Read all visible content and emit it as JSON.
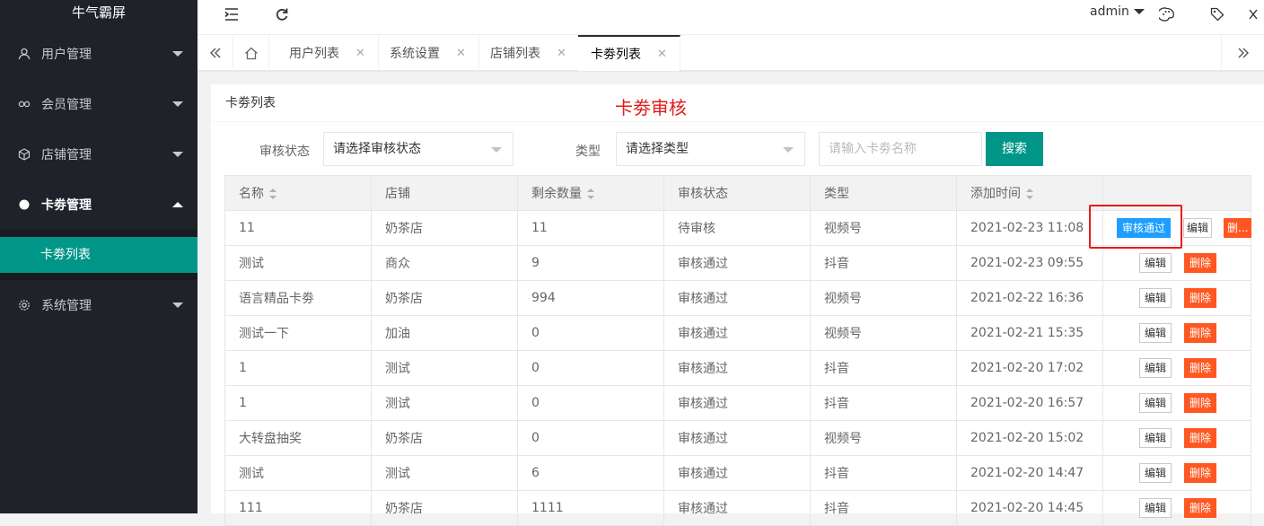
{
  "app": {
    "title": "牛气霸屏"
  },
  "sidebar": {
    "items": [
      {
        "label": "用户管理",
        "icon": "user-icon"
      },
      {
        "label": "会员管理",
        "icon": "link-icon"
      },
      {
        "label": "店铺管理",
        "icon": "box-icon"
      },
      {
        "label": "卡劵管理",
        "icon": "circle-icon"
      },
      {
        "label": "系统管理",
        "icon": "gear-icon"
      }
    ],
    "subitem": "卡劵列表"
  },
  "topbar": {
    "user": "admin"
  },
  "tabs": [
    {
      "label": "用户列表"
    },
    {
      "label": "系统设置"
    },
    {
      "label": "店铺列表"
    },
    {
      "label": "卡劵列表"
    }
  ],
  "panel": {
    "title": "卡劵列表",
    "note": "卡劵审核",
    "filters": {
      "status_label": "审核状态",
      "status_value": "请选择审核状态",
      "type_label": "类型",
      "type_value": "请选择类型",
      "name_placeholder": "请输入卡劵名称",
      "search_label": "搜索"
    }
  },
  "table": {
    "headers": [
      "名称",
      "店铺",
      "剩余数量",
      "审核状态",
      "类型",
      "添加时间",
      ""
    ],
    "rows": [
      [
        "11",
        "奶茶店",
        "11",
        "待审核",
        "视频号",
        "2021-02-23 11:08"
      ],
      [
        "测试",
        "商众",
        "9",
        "审核通过",
        "抖音",
        "2021-02-23 09:55"
      ],
      [
        "语言精品卡劵",
        "奶茶店",
        "994",
        "审核通过",
        "视频号",
        "2021-02-22 16:36"
      ],
      [
        "测试一下",
        "加油",
        "0",
        "审核通过",
        "视频号",
        "2021-02-21 15:35"
      ],
      [
        "1",
        "测试",
        "0",
        "审核通过",
        "抖音",
        "2021-02-20 17:02"
      ],
      [
        "1",
        "测试",
        "0",
        "审核通过",
        "抖音",
        "2021-02-20 16:57"
      ],
      [
        "大转盘抽奖",
        "奶茶店",
        "0",
        "审核通过",
        "视频号",
        "2021-02-20 15:02"
      ],
      [
        "测试",
        "测试",
        "6",
        "审核通过",
        "抖音",
        "2021-02-20 14:47"
      ],
      [
        "111",
        "奶茶店",
        "1111",
        "审核通过",
        "抖音",
        "2021-02-20 14:45"
      ]
    ],
    "actions": {
      "approve": "审核通过",
      "edit": "编辑",
      "delete": "删除",
      "delete_truncated": "删..."
    }
  },
  "colors": {
    "sidebar": "#20222a",
    "accent": "#009688",
    "danger": "#ff5722",
    "primary": "#1e9fff",
    "note": "#e31b1b"
  }
}
